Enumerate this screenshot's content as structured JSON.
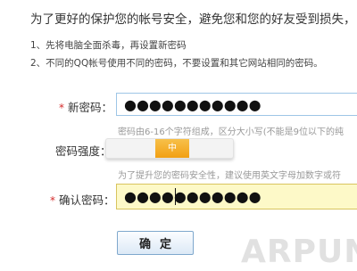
{
  "intro_text": "为了更好的保护您的帐号安全，避免您和您的好友受到损失，",
  "tips": [
    "1、先将电脑全面杀毒，再设置新密码",
    "2、不同的QQ帐号使用不同的密码，不要设置和其它网站相同的密码。"
  ],
  "new_password": {
    "required_mark": "*",
    "label": "新密码：",
    "value": "●●●●●●●●●●●",
    "hint": "密码由6-16个字符组成，区分大小写(不能是9位以下的纯"
  },
  "strength": {
    "label": "密码强度：",
    "level_label": "中"
  },
  "confirm_password": {
    "required_mark": "*",
    "label": "确认密码：",
    "value": "●●●●●●●●●●●",
    "hint": "为了提升您的密码安全性，建议使用英文字母加数字或符"
  },
  "submit_label": "确定",
  "watermark_text": "ARPUN"
}
